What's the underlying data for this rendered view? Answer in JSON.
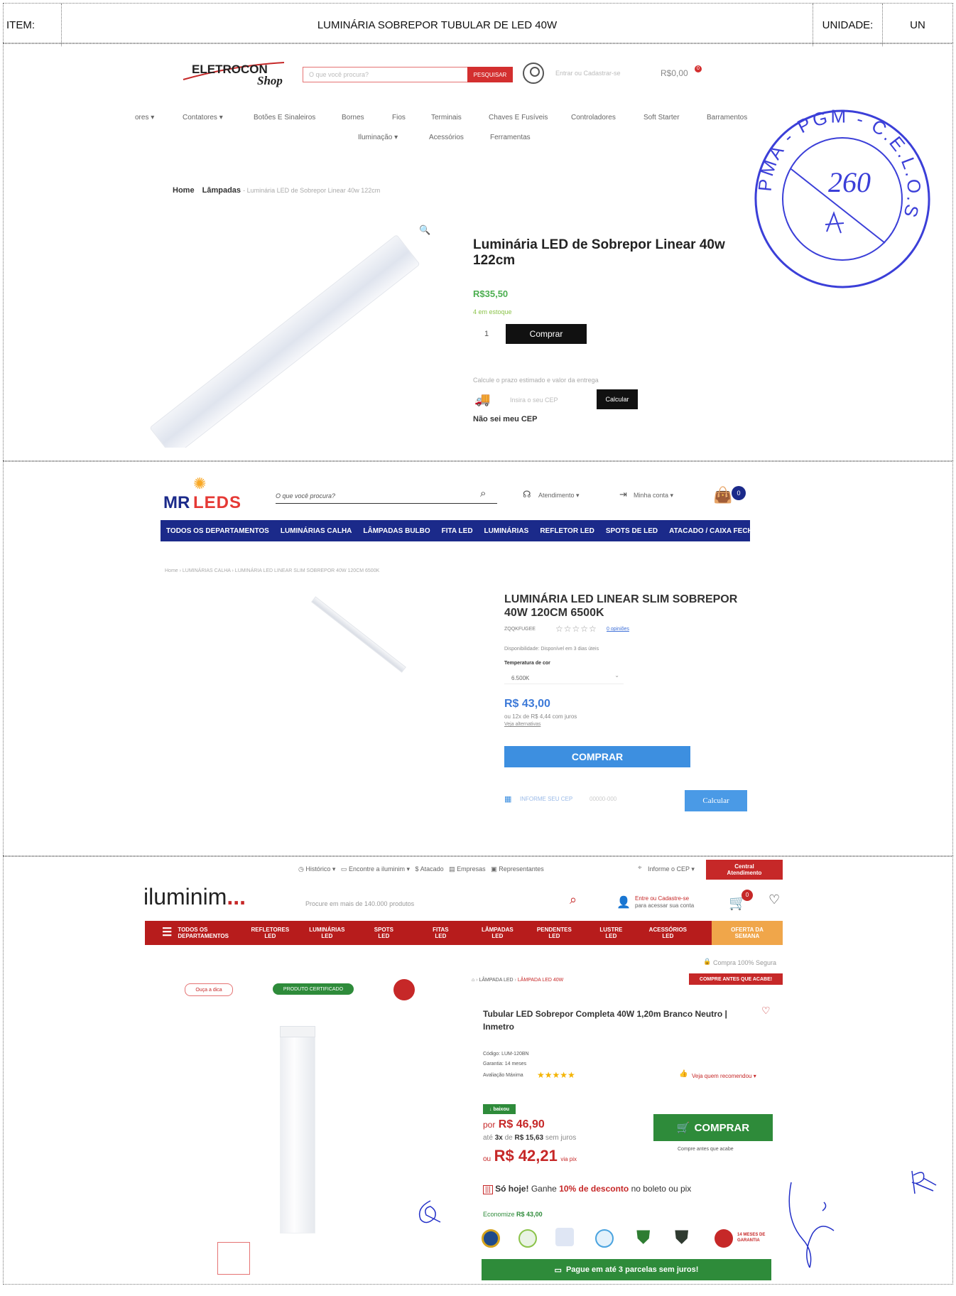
{
  "header": {
    "item_label": "ITEM:",
    "item_title": "LUMINÁRIA SOBREPOR TUBULAR DE LED 40W",
    "unit_label": "UNIDADE:",
    "unit_value": "UN"
  },
  "stamp": {
    "ring_text": "PMA - PGM - C.E.L.O.S",
    "number": "260"
  },
  "shop1": {
    "logo_main": "ELETROCON",
    "logo_sub": "Shop",
    "search_placeholder": "O que você procura?",
    "search_button": "PESQUISAR",
    "account_text": "Entrar ou Cadastrar-se",
    "cart_total": "R$0,00",
    "cart_count": "0",
    "menu_row1": [
      "ores ▾",
      "Contatores ▾",
      "Botões E Sinaleiros",
      "Bornes",
      "Fios",
      "Terminais",
      "Chaves E Fusíveis",
      "Controladores",
      "Soft Starter",
      "Barramentos"
    ],
    "menu_row2": [
      "Iluminação ▾",
      "Acessórios",
      "Ferramentas"
    ],
    "breadcrumb_home": "Home",
    "breadcrumb_cat": "Lâmpadas",
    "breadcrumb_current": "- Luminária LED de Sobrepor Linear 40w 122cm",
    "product_title": "Luminária LED de Sobrepor Linear 40w 122cm",
    "price": "R$35,50",
    "stock": "4 em estoque",
    "qty": "1",
    "buy_button": "Comprar",
    "shipping_hint": "Calcule o prazo estimado e valor da entrega",
    "cep_placeholder": "Insira o seu CEP",
    "calc_button": "Calcular",
    "no_cep": "Não sei meu CEP"
  },
  "shop2": {
    "logo_mr": "MR",
    "logo_leds": "LEDS",
    "search_placeholder": "O que você procura?",
    "support": "Atendimento ▾",
    "account": "Minha conta ▾",
    "cart_count": "0",
    "nav": [
      "TODOS OS DEPARTAMENTOS",
      "LUMINÁRIAS CALHA",
      "LÂMPADAS BULBO",
      "FITA LED",
      "LUMINÁRIAS",
      "REFLETOR LED",
      "SPOTS DE LED",
      "ATACADO / CAIXA FECHADA"
    ],
    "breadcrumb": "Home  ›  LUMINÁRIAS CALHA  ›  LUMINÁRIA LED LINEAR SLIM SOBREPOR 40W 120CM 6500K",
    "product_title": "LUMINÁRIA LED LINEAR SLIM SOBREPOR 40W 120CM 6500K",
    "sku": "ZQQKFUGEE",
    "reviews": "0 opiniões",
    "availability": "Disponibilidade: Disponível em 3 dias úteis",
    "temp_label": "Temperatura de cor",
    "temp_value": "6.500K",
    "price": "R$ 43,00",
    "installments": "ou 12x de R$ 4,44 com juros",
    "more_options": "Veja alternativas",
    "buy_button": "COMPRAR",
    "cep_label": "INFORME SEU CEP",
    "cep_placeholder": "00000-000",
    "calc_button": "Calcular"
  },
  "shop3": {
    "top_links": [
      "Histórico ▾",
      "Encontre a iluminim ▾",
      "Atacado",
      "Empresas",
      "Representantes",
      "Informe o CEP ▾"
    ],
    "central": "Central Atendimento",
    "logo": "iluminim",
    "search_placeholder": "Procure em mais de 140.000 produtos",
    "account_line1": "Entre ou Cadastre-se",
    "account_line2": "para acessar sua conta",
    "cart_count": "0",
    "nav": [
      "TODOS OS\nDEPARTAMENTOS",
      "REFLETORES\nLED",
      "LUMINÁRIAS\nLED",
      "SPOTS\nLED",
      "FITAS\nLED",
      "LÂMPADAS\nLED",
      "PENDENTES\nLED",
      "LUSTRE\nLED",
      "ACESSÓRIOS\nLED"
    ],
    "offer": "OFERTA DA SEMANA",
    "secure": "Compra 100% Segura",
    "listen": "Ouça a dica",
    "certified": "PRODUTO CERTIFICADO",
    "breadcrumb_a": "LÂMPADA LED",
    "breadcrumb_b": "LÂMPADA LED 40W",
    "hurry": "COMPRE ANTES QUE ACABE!",
    "product_title": "Tubular LED Sobrepor Completa 40W 1,20m Branco Neutro | Inmetro",
    "code": "Código: LUM-120BN",
    "warranty": "Garantia: 14 meses",
    "rating_label": "Avaliação Máxima",
    "recommend": "Veja quem recomendou ▾",
    "drop_badge": "baixou",
    "price_label": "por",
    "price": "R$ 46,90",
    "installments_pre": "até",
    "installments_n": "3x",
    "installments_de": "de",
    "installments_value": "R$ 15,63",
    "installments_post": "sem juros",
    "pix_pre": "ou",
    "pix_price": "R$ 42,21",
    "pix_post": "via pix",
    "buy_button": "COMPRAR",
    "buy_hint": "Compre antes que acabe",
    "promo_bold": "Só hoje!",
    "promo_text": "Ganhe",
    "promo_pct": "10% de desconto",
    "promo_tail": "no boleto ou pix",
    "economy_label": "Economize",
    "economy_value": "R$ 43,00",
    "warranty_badge": "14 MESES DE GARANTIA",
    "pay_bar": "Pague em até 3 parcelas sem juros!"
  },
  "colors": {
    "mr_blue": "#1b2a8a",
    "ilum_red": "#b71c1c",
    "green": "#2e8b3a",
    "stamp": "#3b3fd8",
    "light_blue": "#3d8fe0"
  }
}
